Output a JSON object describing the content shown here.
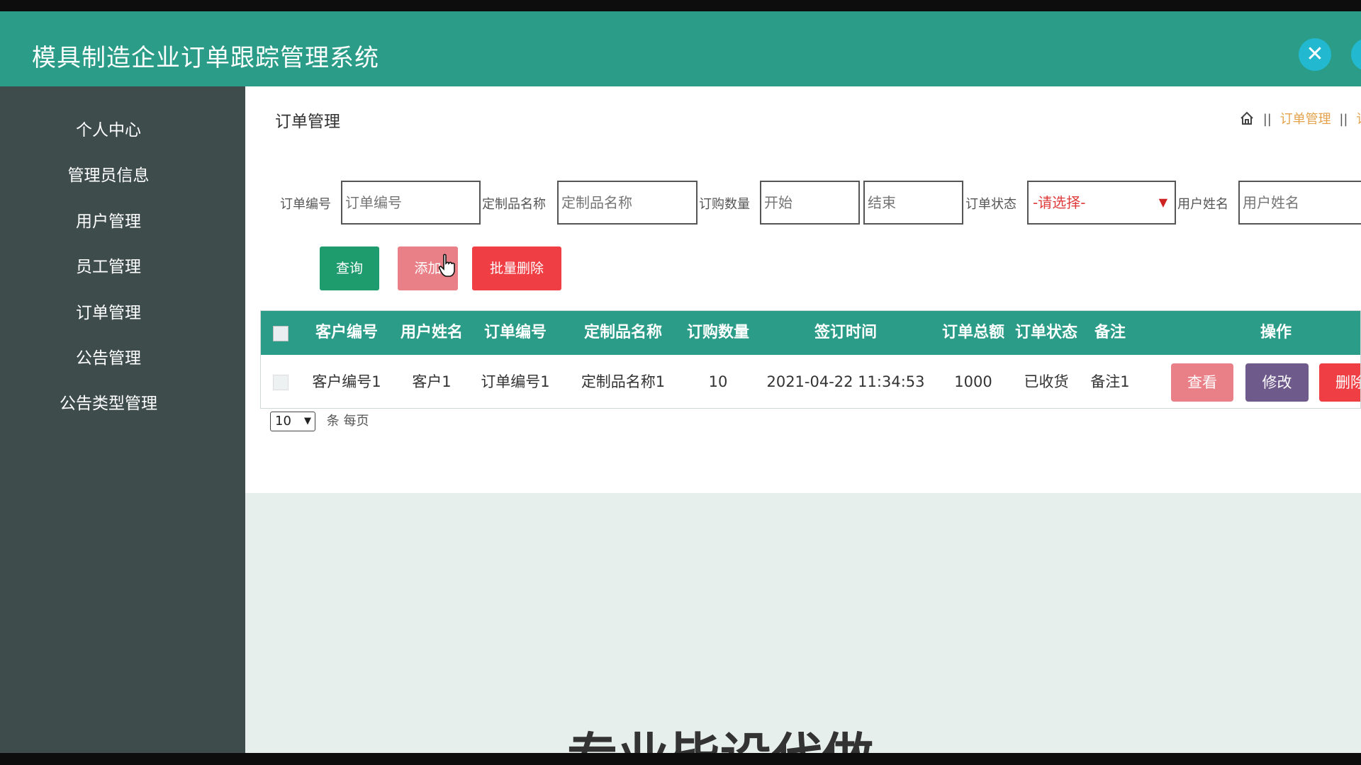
{
  "app": {
    "title": "模具制造企业订单跟踪管理系统"
  },
  "header": {
    "close_icon": "✕",
    "colors": {
      "bar": "#2a9c87",
      "button": "#22b8cf"
    }
  },
  "sidebar": {
    "items": [
      {
        "label": "个人中心"
      },
      {
        "label": "管理员信息"
      },
      {
        "label": "用户管理"
      },
      {
        "label": "员工管理"
      },
      {
        "label": "订单管理"
      },
      {
        "label": "公告管理"
      },
      {
        "label": "公告类型管理"
      }
    ]
  },
  "page": {
    "title": "订单管理",
    "breadcrumb": {
      "home_icon": "home-icon",
      "sep": "||",
      "current": "订单管理",
      "next": "订"
    }
  },
  "filters": {
    "order_no": {
      "label": "订单编号",
      "placeholder": "订单编号"
    },
    "product_name": {
      "label": "定制品名称",
      "placeholder": "定制品名称"
    },
    "quantity": {
      "label": "订购数量",
      "start_placeholder": "开始",
      "end_placeholder": "结束"
    },
    "status": {
      "label": "订单状态",
      "selected": "-请选择-"
    },
    "username": {
      "label": "用户姓名",
      "placeholder": "用户姓名"
    }
  },
  "actions": {
    "query": "查询",
    "add": "添加",
    "batch_delete": "批量删除"
  },
  "table": {
    "headers": {
      "customer_no": "客户编号",
      "username": "用户姓名",
      "order_no": "订单编号",
      "product_name": "定制品名称",
      "quantity": "订购数量",
      "sign_time": "签订时间",
      "total": "订单总额",
      "status": "订单状态",
      "remark": "备注",
      "ops": "操作"
    },
    "rows": [
      {
        "customer_no": "客户编号1",
        "username": "客户1",
        "order_no": "订单编号1",
        "product_name": "定制品名称1",
        "quantity": "10",
        "sign_time": "2021-04-22 11:34:53",
        "total": "1000",
        "status": "已收货",
        "remark": "备注1",
        "view": "查看",
        "edit": "修改",
        "delete": "删除"
      }
    ]
  },
  "pager": {
    "page_size": "10",
    "per_page_text": "条 每页"
  },
  "watermark": {
    "text": "专业毕设代做"
  }
}
